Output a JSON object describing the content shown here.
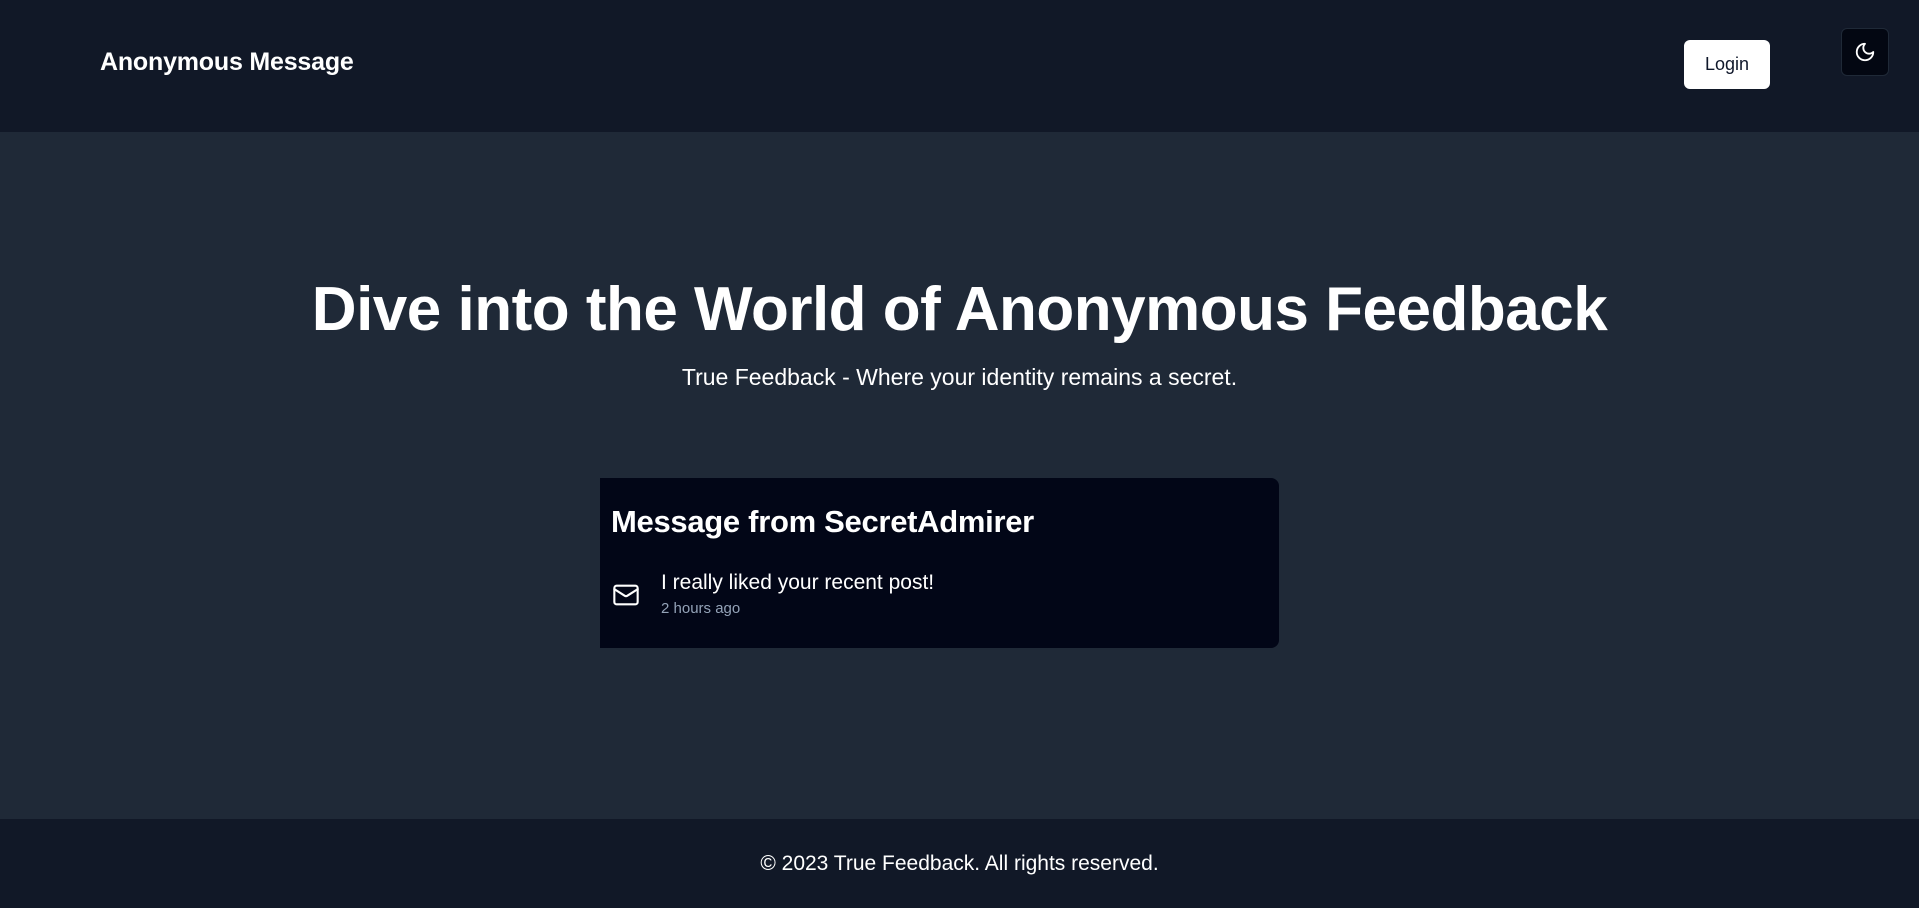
{
  "header": {
    "brand": "Anonymous Message",
    "login_label": "Login",
    "theme_toggle_icon": "moon-icon"
  },
  "hero": {
    "title": "Dive into the World of Anonymous Feedback",
    "subtitle": "True Feedback - Where your identity remains a secret."
  },
  "message_card": {
    "title": "Message from SecretAdmirer",
    "icon": "mail-icon",
    "content": "I really liked your recent post!",
    "received": "2 hours ago"
  },
  "footer": {
    "text": "© 2023 True Feedback. All rights reserved."
  },
  "colors": {
    "header_bg": "#111827",
    "main_bg": "#1f2937",
    "card_bg": "#020617",
    "muted_text": "#94a3b8"
  }
}
